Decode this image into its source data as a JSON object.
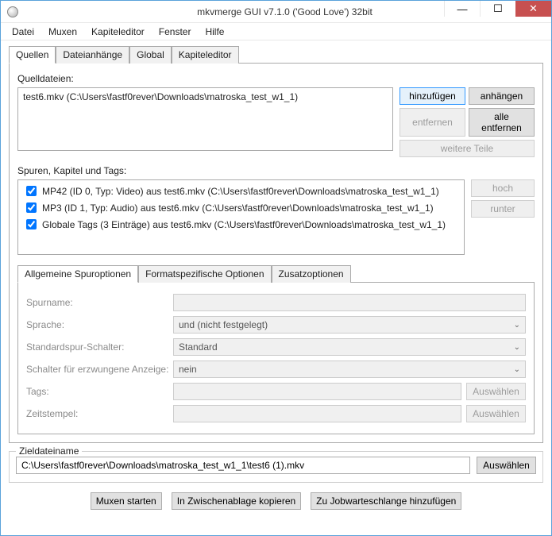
{
  "window": {
    "title": "mkvmerge GUI v7.1.0 ('Good Love') 32bit"
  },
  "menu": {
    "file": "Datei",
    "muxen": "Muxen",
    "chapters": "Kapiteleditor",
    "window": "Fenster",
    "help": "Hilfe"
  },
  "tabs": {
    "sources": "Quellen",
    "attachments": "Dateianhänge",
    "global": "Global",
    "chaptereditor": "Kapiteleditor"
  },
  "labels": {
    "source_files": "Quelldateien:",
    "tracks": "Spuren, Kapitel und Tags:",
    "general_opts": "Allgemeine Spuroptionen",
    "format_opts": "Formatspezifische Optionen",
    "extra_opts": "Zusatzoptionen",
    "trackname": "Spurname:",
    "language": "Sprache:",
    "default_flag": "Standardspur-Schalter:",
    "forced_flag": "Schalter für erzwungene Anzeige:",
    "tags": "Tags:",
    "timestamps": "Zeitstempel:",
    "dest": "Zieldateiname"
  },
  "buttons": {
    "add": "hinzufügen",
    "append": "anhängen",
    "remove": "entfernen",
    "remove_all": "alle entfernen",
    "more_parts": "weitere Teile",
    "up": "hoch",
    "down": "runter",
    "choose": "Auswählen",
    "start": "Muxen starten",
    "copy_cmd": "In Zwischenablage kopieren",
    "queue": "Zu Jobwarteschlange hinzufügen"
  },
  "sources": [
    "test6.mkv (C:\\Users\\fastf0rever\\Downloads\\matroska_test_w1_1)"
  ],
  "tracks": [
    "MP42 (ID 0, Typ: Video) aus test6.mkv (C:\\Users\\fastf0rever\\Downloads\\matroska_test_w1_1)",
    "MP3 (ID 1, Typ: Audio) aus test6.mkv (C:\\Users\\fastf0rever\\Downloads\\matroska_test_w1_1)",
    "Globale Tags (3 Einträge) aus test6.mkv (C:\\Users\\fastf0rever\\Downloads\\matroska_test_w1_1)"
  ],
  "form": {
    "language": "und (nicht festgelegt)",
    "default_flag": "Standard",
    "forced_flag": "nein"
  },
  "dest": {
    "path": "C:\\Users\\fastf0rever\\Downloads\\matroska_test_w1_1\\test6 (1).mkv"
  }
}
